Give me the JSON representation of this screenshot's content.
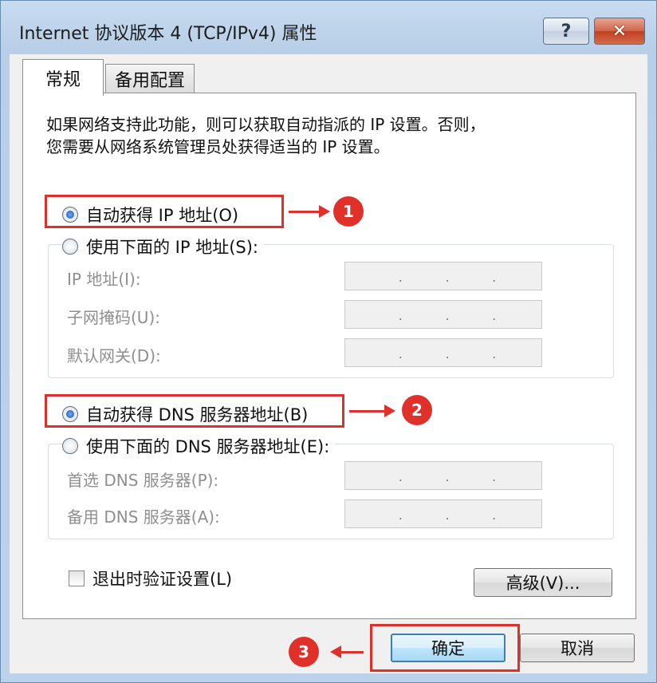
{
  "window": {
    "title": "Internet 协议版本 4 (TCP/IPv4) 属性"
  },
  "caption_buttons": {
    "help": "?",
    "close": "✕"
  },
  "tabs": [
    {
      "label": "常规",
      "active": true
    },
    {
      "label": "备用配置",
      "active": false
    }
  ],
  "intro": {
    "line1": "如果网络支持此功能，则可以获取自动指派的 IP 设置。否则，",
    "line2": "您需要从网络系统管理员处获得适当的 IP 设置。"
  },
  "ip_section": {
    "auto_label": "自动获得 IP 地址(O)",
    "auto_selected": true,
    "manual_label": "使用下面的 IP 地址(S):",
    "manual_selected": false,
    "fields": [
      {
        "label": "IP 地址(I):"
      },
      {
        "label": "子网掩码(U):"
      },
      {
        "label": "默认网关(D):"
      }
    ]
  },
  "dns_section": {
    "auto_label": "自动获得 DNS 服务器地址(B)",
    "auto_selected": true,
    "manual_label": "使用下面的 DNS 服务器地址(E):",
    "manual_selected": false,
    "fields": [
      {
        "label": "首选 DNS 服务器(P):"
      },
      {
        "label": "备用 DNS 服务器(A):"
      }
    ]
  },
  "ip_dots": ".",
  "validate_checkbox": {
    "label": "退出时验证设置(L)",
    "checked": false
  },
  "buttons": {
    "advanced": "高级(V)...",
    "ok": "确定",
    "cancel": "取消"
  },
  "annotations": {
    "badge1": "1",
    "badge2": "2",
    "badge3": "3",
    "color": "#e0302a"
  }
}
